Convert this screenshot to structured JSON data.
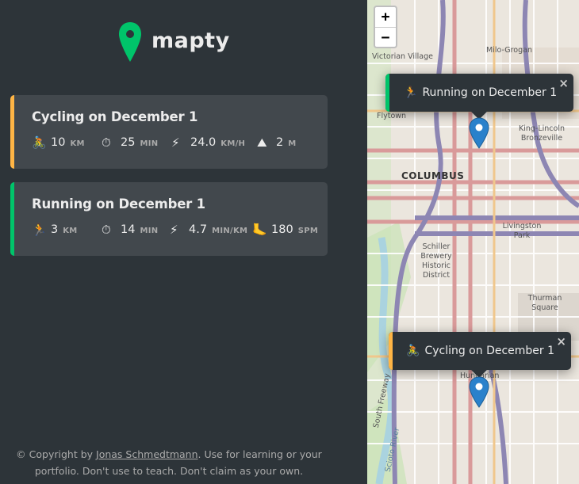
{
  "app": {
    "name": "mapty"
  },
  "workouts": [
    {
      "type": "cycling",
      "title": "Cycling on December 1",
      "details": [
        {
          "icon": "cyclist-icon",
          "glyph": "🚴",
          "value": "10",
          "unit": "KM"
        },
        {
          "icon": "stopwatch-icon",
          "glyph": "⏱",
          "value": "25",
          "unit": "MIN"
        },
        {
          "icon": "lightning-icon",
          "glyph": "⚡",
          "value": "24.0",
          "unit": "KM/H"
        },
        {
          "icon": "mountain-icon",
          "glyph": "⛰",
          "value": "2",
          "unit": "M"
        }
      ]
    },
    {
      "type": "running",
      "title": "Running on December 1",
      "details": [
        {
          "icon": "runner-icon",
          "glyph": "🏃",
          "value": "3",
          "unit": "KM"
        },
        {
          "icon": "stopwatch-icon",
          "glyph": "⏱",
          "value": "14",
          "unit": "MIN"
        },
        {
          "icon": "lightning-icon",
          "glyph": "⚡",
          "value": "4.7",
          "unit": "MIN/KM"
        },
        {
          "icon": "footprint-icon",
          "glyph": "🦶",
          "value": "180",
          "unit": "SPM"
        }
      ]
    }
  ],
  "copyright": {
    "prefix": "© Copyright by ",
    "author": "Jonas Schmedtmann",
    "suffix": ". Use for learning or your portfolio. Don't use to teach. Don't claim as your own."
  },
  "map": {
    "zoom_in": "+",
    "zoom_out": "−",
    "city": "COLUMBUS",
    "labels": {
      "victorian_village": "Victorian Village",
      "milo_grogan": "Milo-Grogan",
      "flytown": "Flytown",
      "king_lincoln": "King-Lincoln Bronzeville",
      "livingston_park": "Livingston Park",
      "schiller": "Schiller Brewery Historic District",
      "thurman": "Thurman Square",
      "hungarian": "Hungarian",
      "south_freeway": "South Freeway",
      "scioto_river": "Scioto River"
    },
    "popups": [
      {
        "type": "running",
        "glyph": "🏃",
        "text": "Running on December 1",
        "close": "×"
      },
      {
        "type": "cycling",
        "glyph": "🚴",
        "text": "Cycling on December 1",
        "close": "×"
      }
    ]
  },
  "colors": {
    "running": "#00c46a",
    "cycling": "#ffb545",
    "bg_dark": "#2d3439",
    "card": "#42484d"
  }
}
